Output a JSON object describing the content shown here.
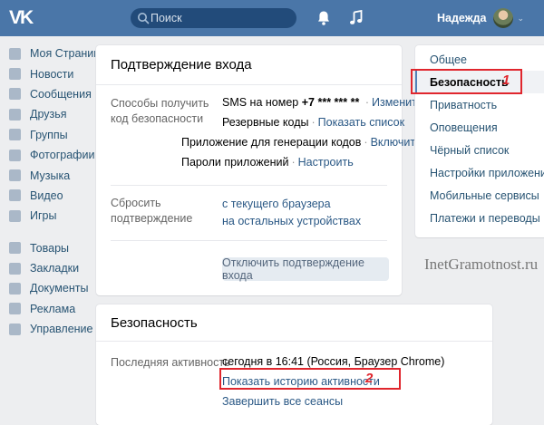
{
  "header": {
    "logo": "VK",
    "search_placeholder": "Поиск",
    "user_name": "Надежда",
    "chevron": "⌄"
  },
  "leftnav": [
    {
      "label": "Моя Страница",
      "icon": "home-icon"
    },
    {
      "label": "Новости",
      "icon": "news-icon"
    },
    {
      "label": "Сообщения",
      "icon": "messages-icon"
    },
    {
      "label": "Друзья",
      "icon": "friends-icon"
    },
    {
      "label": "Группы",
      "icon": "groups-icon"
    },
    {
      "label": "Фотографии",
      "icon": "photos-icon"
    },
    {
      "label": "Музыка",
      "icon": "music-icon"
    },
    {
      "label": "Видео",
      "icon": "video-icon"
    },
    {
      "label": "Игры",
      "icon": "games-icon"
    },
    {
      "label": "Товары",
      "icon": "goods-icon"
    },
    {
      "label": "Закладки",
      "icon": "bookmarks-icon"
    },
    {
      "label": "Документы",
      "icon": "documents-icon"
    },
    {
      "label": "Реклама",
      "icon": "ads-icon"
    },
    {
      "label": "Управление",
      "icon": "manage-icon"
    }
  ],
  "login_confirm": {
    "title": "Подтверждение входа",
    "methods_label": "Способы получить код безопасности",
    "sms_text": "SMS на номер",
    "sms_phone": "+7 *** *** **",
    "sms_action": "Изменить",
    "backup_text": "Резервные коды",
    "backup_action": "Показать список",
    "app_text": "Приложение для генерации кодов",
    "app_action": "Включить",
    "passwords_text": "Пароли приложений",
    "passwords_action": "Настроить",
    "reset_label": "Сбросить подтверждение",
    "reset_browser": "с текущего браузера",
    "reset_devices": "на остальных устройствах",
    "disable_button": "Отключить подтверждение входа"
  },
  "security": {
    "title": "Безопасность",
    "last_activity_label": "Последняя активность",
    "last_activity_value": "сегодня в 16:41 (Россия, Браузер Chrome)",
    "show_history": "Показать историю активности",
    "end_sessions": "Завершить все сеансы"
  },
  "rightmenu": [
    {
      "label": "Общее",
      "active": false
    },
    {
      "label": "Безопасность",
      "active": true
    },
    {
      "label": "Приватность",
      "active": false
    },
    {
      "label": "Оповещения",
      "active": false
    },
    {
      "label": "Чёрный список",
      "active": false
    },
    {
      "label": "Настройки приложений",
      "active": false
    },
    {
      "label": "Мобильные сервисы",
      "active": false
    },
    {
      "label": "Платежи и переводы",
      "active": false
    }
  ],
  "annotations": {
    "one": "1",
    "two": "2"
  },
  "watermark": "InetGramotnost.ru",
  "colors": {
    "header": "#4a76a8",
    "link": "#2a5885",
    "accent_red": "#e0262d"
  }
}
